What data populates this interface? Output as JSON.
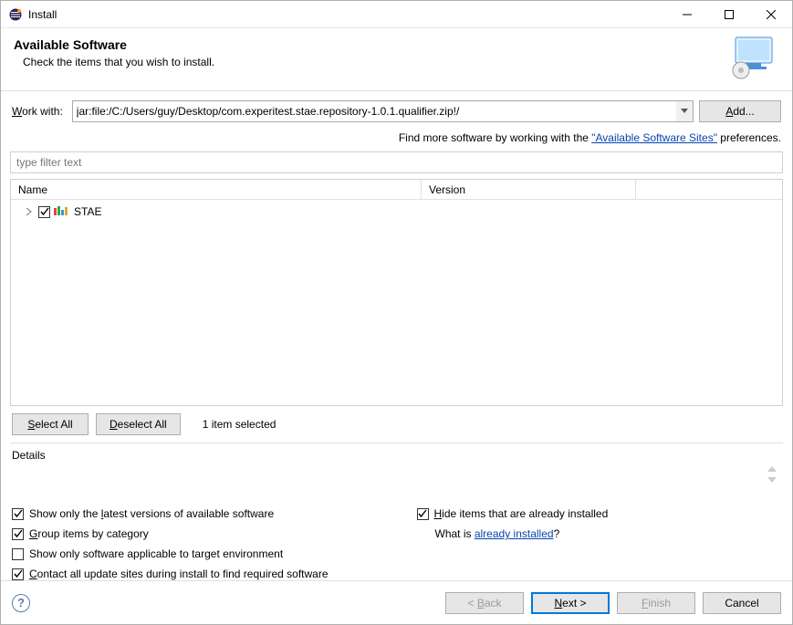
{
  "window": {
    "title": "Install"
  },
  "header": {
    "heading": "Available Software",
    "subheading": "Check the items that you wish to install."
  },
  "workwith": {
    "label_pre": "W",
    "label_post": "ork with:",
    "value": "jar:file:/C:/Users/guy/Desktop/com.experitest.stae.repository-1.0.1.qualifier.zip!/",
    "add_pre": "A",
    "add_post": "dd..."
  },
  "findmore": {
    "prefix": "Find more software by working with the ",
    "link": "\"Available Software Sites\"",
    "suffix": " preferences."
  },
  "filter": {
    "placeholder": "type filter text"
  },
  "tree": {
    "columns": {
      "name": "Name",
      "version": "Version"
    },
    "items": [
      {
        "label": "STAE",
        "checked": true,
        "expandable": true
      }
    ]
  },
  "selection": {
    "select_all_pre": "S",
    "select_all_post": "elect All",
    "deselect_all_pre": "D",
    "deselect_all_post": "eselect All",
    "count_text": "1 item selected"
  },
  "details": {
    "legend": "Details"
  },
  "options": {
    "show_latest_pre": "Show only the ",
    "show_latest_u": "l",
    "show_latest_post": "atest versions of available software",
    "group_pre": "G",
    "group_post": "roup items by category",
    "applicable": "Show only software applicable to target environment",
    "contact_pre": "C",
    "contact_post": "ontact all update sites during install to find required software",
    "hide_pre": "H",
    "hide_post": "ide items that are already installed",
    "whatis_prefix": "What is ",
    "whatis_link": "already installed",
    "whatis_suffix": "?"
  },
  "footer": {
    "back_pre": "< ",
    "back_u": "B",
    "back_post": "ack",
    "next_pre": "N",
    "next_post": "ext >",
    "finish_pre": "F",
    "finish_post": "inish",
    "cancel": "Cancel"
  }
}
